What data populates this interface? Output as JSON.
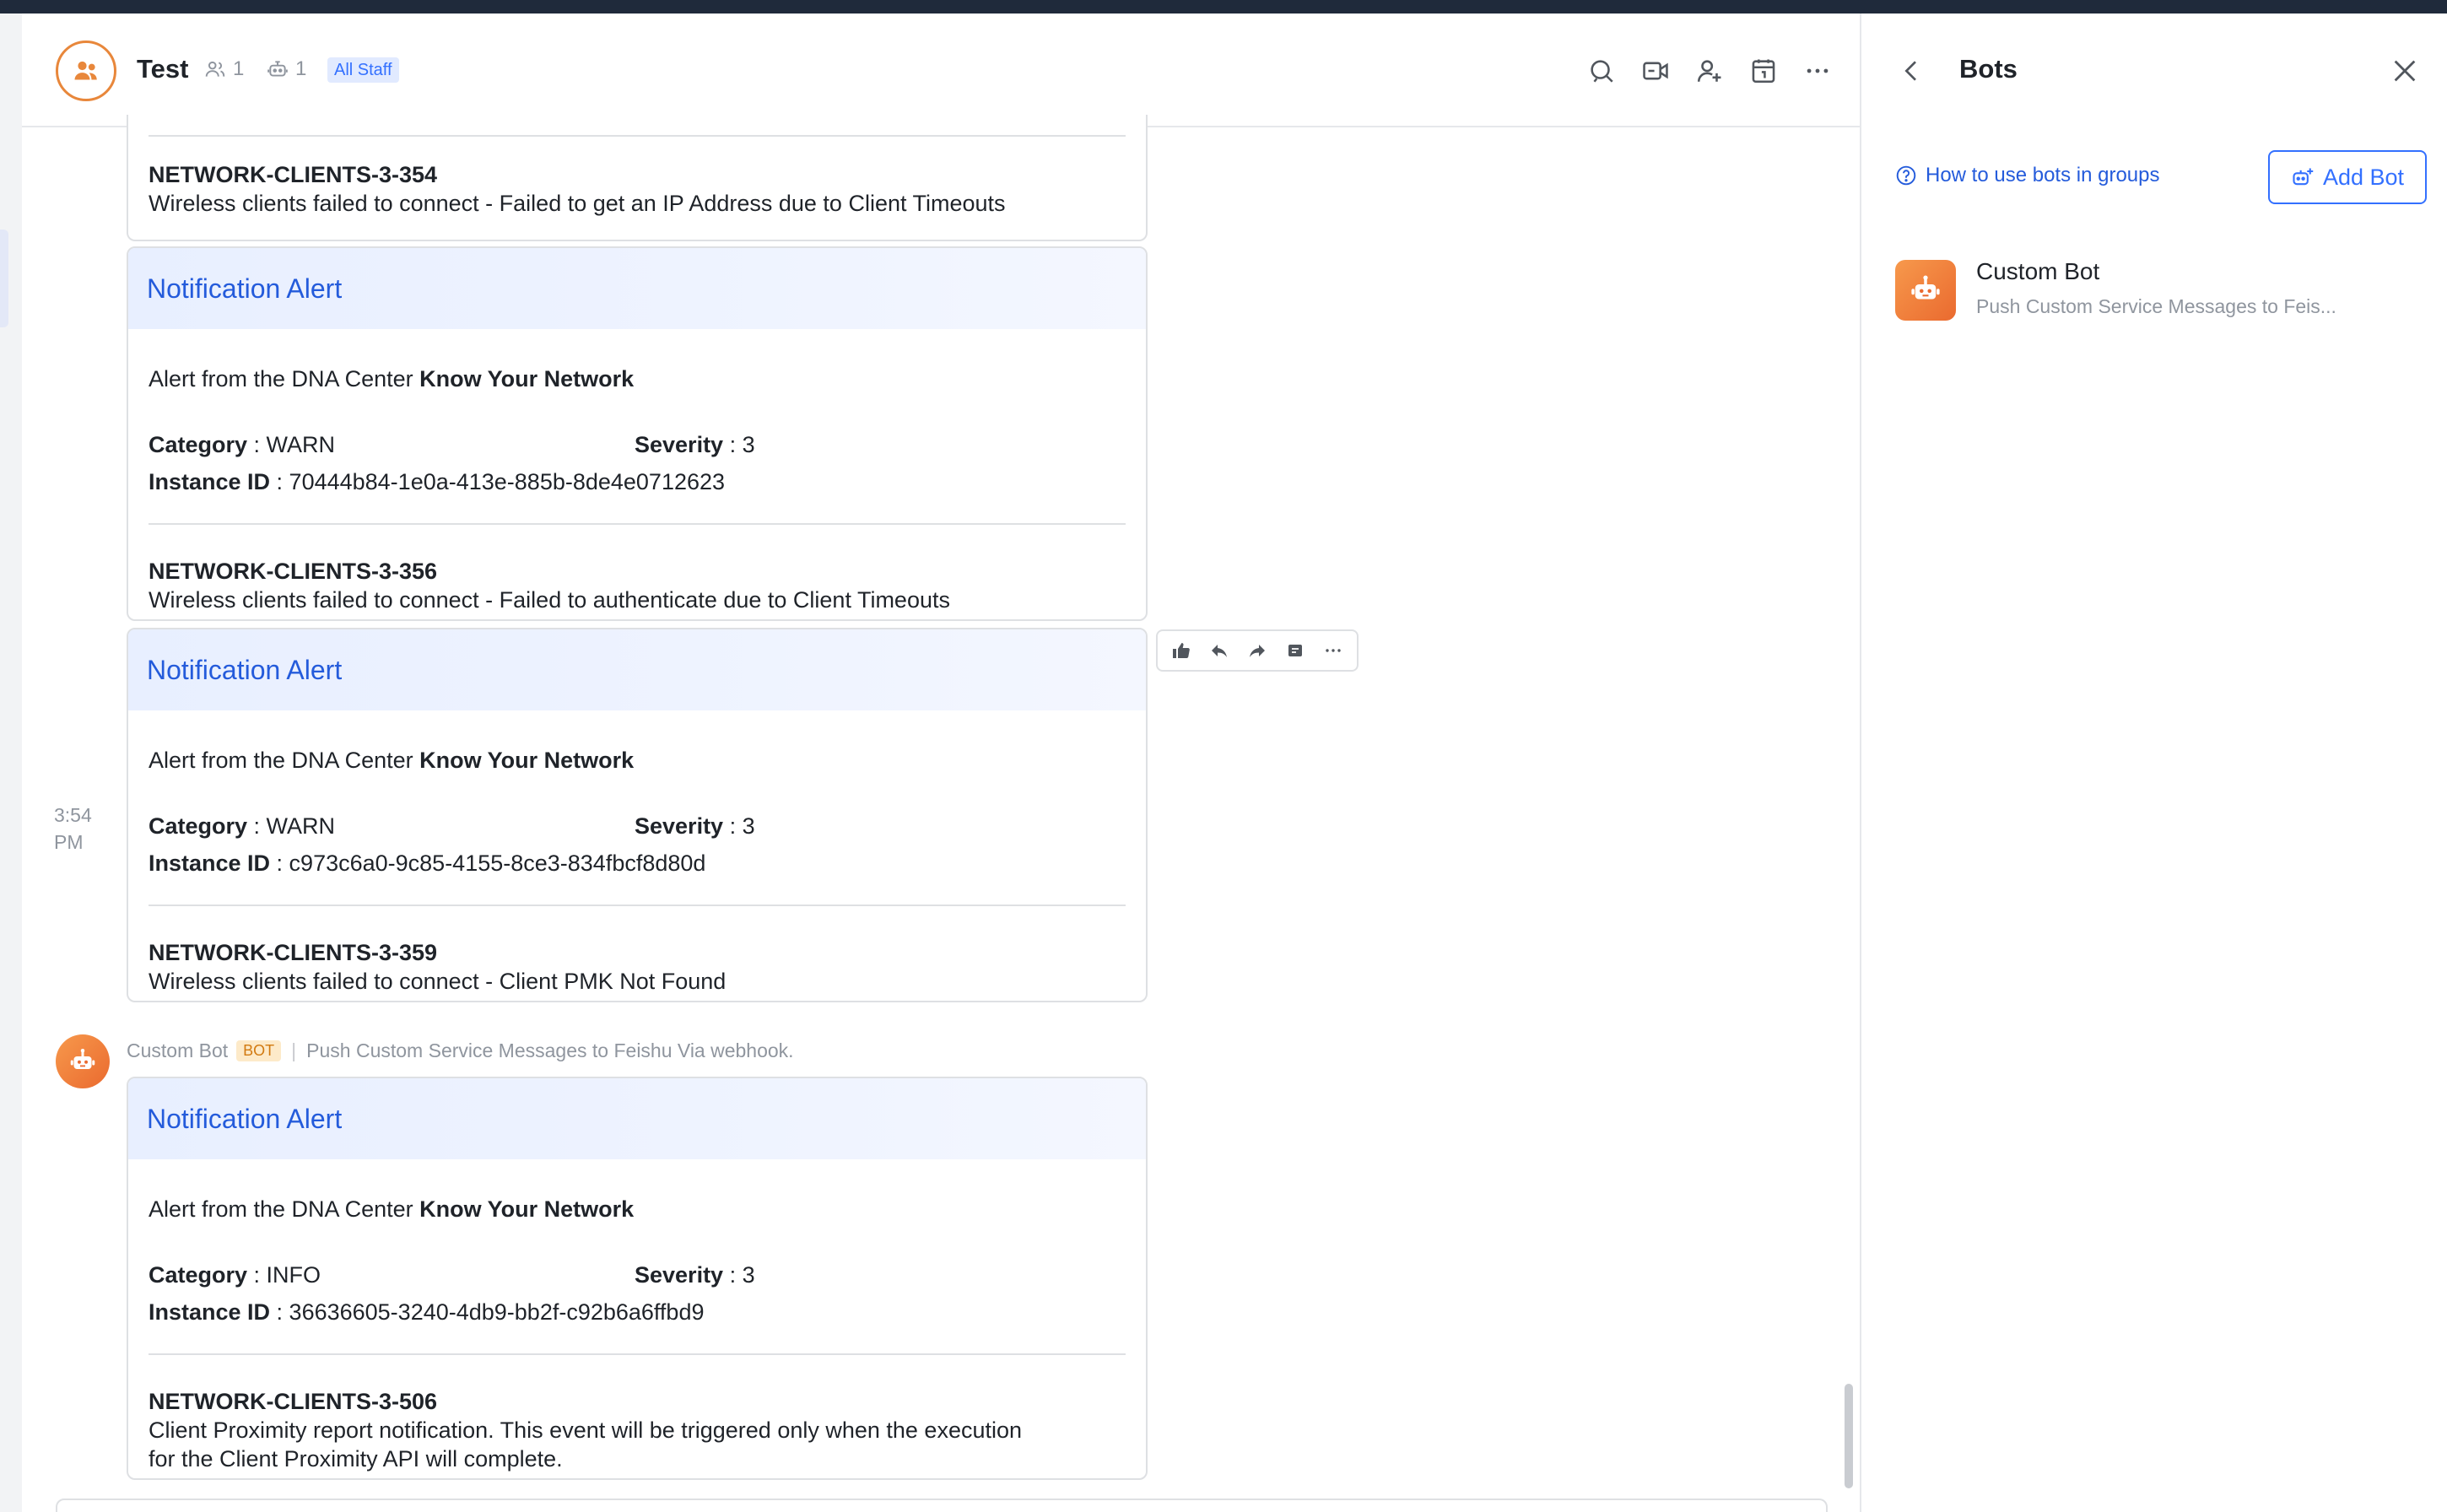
{
  "header": {
    "title": "Test",
    "member_count": "1",
    "bot_count": "1",
    "badge": "All Staff"
  },
  "messages": {
    "timestamp": "3:54\nPM",
    "card1": {
      "event_id": "NETWORK-CLIENTS-3-354",
      "event_desc": "Wireless clients failed to connect - Failed to get an IP Address due to Client Timeouts"
    },
    "card2": {
      "title": "Notification Alert",
      "intro": "Alert from the DNA Center ",
      "intro_bold": "Know Your Network",
      "category_label": "Category",
      "category_value": " : WARN",
      "severity_label": "Severity",
      "severity_value": " : 3",
      "instance_label": "Instance ID",
      "instance_value": " : 70444b84-1e0a-413e-885b-8de4e0712623",
      "event_id": "NETWORK-CLIENTS-3-356",
      "event_desc": "Wireless clients failed to connect - Failed to authenticate due to Client Timeouts"
    },
    "card3": {
      "title": "Notification Alert",
      "intro": "Alert from the DNA Center ",
      "intro_bold": "Know Your Network",
      "category_label": "Category",
      "category_value": " : WARN",
      "severity_label": "Severity",
      "severity_value": " : 3",
      "instance_label": "Instance ID",
      "instance_value": " : c973c6a0-9c85-4155-8ce3-834fbcf8d80d",
      "event_id": "NETWORK-CLIENTS-3-359",
      "event_desc": "Wireless clients failed to connect - Client PMK Not Found"
    },
    "sender": {
      "name": "Custom Bot",
      "tag": "BOT",
      "separator": "|",
      "description": "Push Custom Service Messages to Feishu Via webhook."
    },
    "card4": {
      "title": "Notification Alert",
      "intro": "Alert from the DNA Center ",
      "intro_bold": "Know Your Network",
      "category_label": "Category",
      "category_value": " : INFO",
      "severity_label": "Severity",
      "severity_value": " : 3",
      "instance_label": "Instance ID",
      "instance_value": " : 36636605-3240-4db9-bb2f-c92b6a6ffbd9",
      "event_id": "NETWORK-CLIENTS-3-506",
      "event_desc_line1": "Client Proximity report notification. This event will be triggered only when the execution",
      "event_desc_line2": "for the Client Proximity API will complete."
    }
  },
  "panel": {
    "title": "Bots",
    "howto": "How to use bots in groups",
    "add_bot": "Add Bot",
    "bots": [
      {
        "name": "Custom Bot",
        "description": "Push Custom Service Messages to Feis..."
      }
    ]
  },
  "colors": {
    "accent": "#3370ff",
    "link": "#245bdb",
    "bot_orange": "#ea6a2f",
    "topbar": "#1f2a3b"
  },
  "icons": {
    "header": [
      "search-icon",
      "video-call-icon",
      "add-member-icon",
      "calendar-icon",
      "more-icon"
    ],
    "hover_toolbar": [
      "thumbs-up-icon",
      "reply-icon",
      "forward-icon",
      "pin-icon",
      "more-icon"
    ],
    "panel": [
      "back-icon",
      "close-icon",
      "help-icon",
      "add-bot-icon"
    ]
  }
}
